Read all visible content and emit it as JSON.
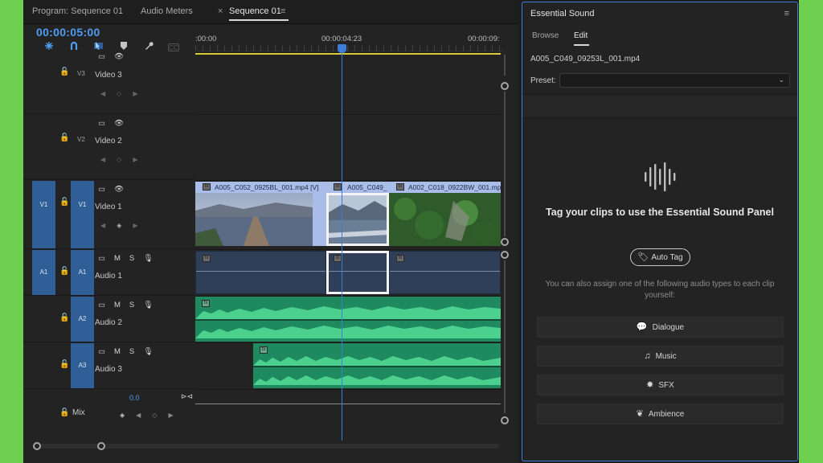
{
  "tabs": {
    "program": "Program: Sequence 01",
    "audio_meters": "Audio Meters",
    "close": "×",
    "sequence": "Sequence 01",
    "menu": "≡"
  },
  "timeline": {
    "timecode": "00:00:05:00",
    "ruler_labels": [
      ":00:00",
      "00:00:04:23",
      "00:00:09:"
    ],
    "playhead_time": "00:00:04:23",
    "tools": [
      "snap-icon",
      "linked-selection-icon",
      "selection-marker-icon",
      "add-marker-icon",
      "wrench-icon",
      "captions-icon"
    ],
    "tool_captions": "CC",
    "tracks": [
      {
        "id": "V3",
        "name": "Video 3"
      },
      {
        "id": "V2",
        "name": "Video 2"
      },
      {
        "id": "V1",
        "source": "V1",
        "name": "Video 1"
      },
      {
        "id": "A1",
        "source": "A1",
        "name": "Audio 1",
        "m": "M",
        "s": "S"
      },
      {
        "id": "A2",
        "name": "Audio 2",
        "m": "M",
        "s": "S"
      },
      {
        "id": "A3",
        "name": "Audio 3",
        "m": "M",
        "s": "S"
      }
    ],
    "mix": {
      "name": "Mix",
      "value": "0.0"
    },
    "clips": [
      {
        "label": "A005_C052_0925BL_001.mp4 [V]"
      },
      {
        "label": "A005_C049_"
      },
      {
        "label": "A002_C018_0922BW_001.mp"
      }
    ],
    "fx": "fx"
  },
  "essential_sound": {
    "title": "Essential Sound",
    "menu": "≡",
    "tab_browse": "Browse",
    "tab_edit": "Edit",
    "file": "A005_C049_09253L_001.mp4",
    "preset_label": "Preset:",
    "preset_value": "",
    "heading": "Tag your clips to use the Essential Sound Panel",
    "auto_tag": "Auto Tag",
    "description": "You can also assign one of the following audio types to each clip yourself:",
    "types": [
      {
        "label": "Dialogue",
        "icon": "dialogue-icon"
      },
      {
        "label": "Music",
        "icon": "music-icon"
      },
      {
        "label": "SFX",
        "icon": "sfx-icon"
      },
      {
        "label": "Ambience",
        "icon": "ambience-icon"
      }
    ]
  },
  "colors": {
    "accent": "#4f9cf0",
    "track_target": "#2f5f96",
    "video_clip_label": "#a9bde8",
    "audio_clip": "#2f3f57",
    "audio_green": "#1f8a60",
    "work_bar": "#d8c93a",
    "background_frame": "#6fcf4f"
  }
}
